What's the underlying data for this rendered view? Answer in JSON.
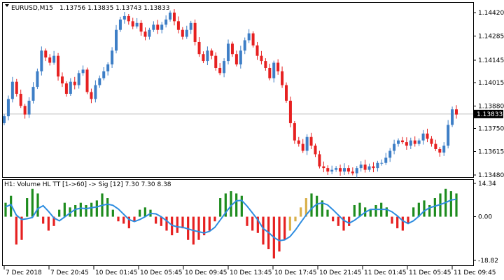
{
  "window": {
    "symbol_info": "EURUSD,M15",
    "ohlc": "1.13756 1.13835 1.13743 1.13833",
    "current_price": "1.13833",
    "collapse_icon": "triangle-down-icon"
  },
  "indicator": {
    "title": "H1: Volume HL TT [1->60] -> Sig [12] 7.30 7.30 8.38"
  },
  "colors": {
    "background": "#ffffff",
    "frame": "#000000",
    "bull_candle": "#3d7ec6",
    "bear_candle": "#e62020",
    "price_line": "#c0c0c0",
    "hist_green": "#1e8c1e",
    "hist_red": "#e62020",
    "hist_gold": "#d9b04a",
    "signal_line": "#2e8de0",
    "price_label_bg": "#000000",
    "price_label_fg": "#ffffff"
  },
  "chart_data": [
    {
      "type": "candlestick",
      "title": "EURUSD,M15",
      "y_ticks": [
        "1.14420",
        "1.14285",
        "1.14145",
        "1.14015",
        "1.13880",
        "1.13750",
        "1.13615",
        "1.13480"
      ],
      "ylim": [
        1.1348,
        1.1442
      ],
      "x_ticks": [
        "7 Dec 2018",
        "7 Dec 20:45",
        "10 Dec 01:45",
        "10 Dec 05:45",
        "10 Dec 09:45",
        "10 Dec 13:45",
        "10 Dec 17:45",
        "10 Dec 21:45",
        "11 Dec 01:45",
        "11 Dec 05:45",
        "11 Dec 09:45"
      ],
      "current_price": 1.13833,
      "close_path": [
        1.1382,
        1.1392,
        1.1402,
        1.1395,
        1.1388,
        1.1383,
        1.1391,
        1.1399,
        1.1408,
        1.142,
        1.1416,
        1.1413,
        1.1417,
        1.1405,
        1.1401,
        1.1395,
        1.1402,
        1.14,
        1.1407,
        1.1409,
        1.1396,
        1.1392,
        1.14,
        1.1404,
        1.1408,
        1.1412,
        1.142,
        1.1432,
        1.1438,
        1.144,
        1.1437,
        1.1434,
        1.1436,
        1.1431,
        1.1428,
        1.1432,
        1.1435,
        1.1432,
        1.1435,
        1.1438,
        1.1442,
        1.1437,
        1.1432,
        1.1428,
        1.1432,
        1.1436,
        1.1425,
        1.1418,
        1.1414,
        1.142,
        1.1417,
        1.141,
        1.1407,
        1.1414,
        1.1424,
        1.1418,
        1.1412,
        1.142,
        1.1426,
        1.143,
        1.1423,
        1.1417,
        1.1414,
        1.141,
        1.1404,
        1.1413,
        1.1408,
        1.14,
        1.1391,
        1.1378,
        1.1368,
        1.1366,
        1.1362,
        1.137,
        1.1365,
        1.136,
        1.1353,
        1.1352,
        1.135,
        1.1351,
        1.1352,
        1.135,
        1.1352,
        1.135,
        1.1349,
        1.1352,
        1.1354,
        1.1351,
        1.1353,
        1.1352,
        1.1355,
        1.1355,
        1.1358,
        1.1362,
        1.1366,
        1.1368,
        1.1367,
        1.1365,
        1.1368,
        1.1366,
        1.1368,
        1.1372,
        1.1369,
        1.1366,
        1.1363,
        1.1361,
        1.1365,
        1.1377,
        1.1386,
        1.1383
      ]
    },
    {
      "type": "bar",
      "title": "H1: Volume HL TT [1->60] -> Sig [12] 7.30 7.30 8.38",
      "y_ticks": [
        "14.34",
        "0.00",
        "-18.82"
      ],
      "ylim": [
        -18.82,
        14.34
      ],
      "series": [
        {
          "values": [
            6,
            9,
            -12,
            -10,
            8,
            12,
            10,
            -3,
            -6,
            -4,
            3,
            6,
            4,
            5,
            6,
            5,
            6,
            7,
            10,
            8,
            3,
            -2,
            -3,
            -5,
            -2,
            3,
            4,
            3,
            -3,
            -4,
            -6,
            -8,
            -7,
            -5,
            -10,
            -12,
            -10,
            -8,
            -6,
            -2,
            8,
            10,
            11,
            10,
            9,
            -4,
            -6,
            -7,
            -12,
            -14,
            -18,
            -15,
            -10,
            -6,
            -2,
            4,
            8,
            10,
            9,
            7,
            3,
            -2,
            -4,
            -6,
            -4,
            5,
            6,
            4,
            3,
            5,
            6,
            4,
            -3,
            -5,
            -6,
            -3,
            4,
            6,
            7,
            5,
            8,
            10,
            12,
            11,
            10
          ]
        }
      ]
    }
  ]
}
